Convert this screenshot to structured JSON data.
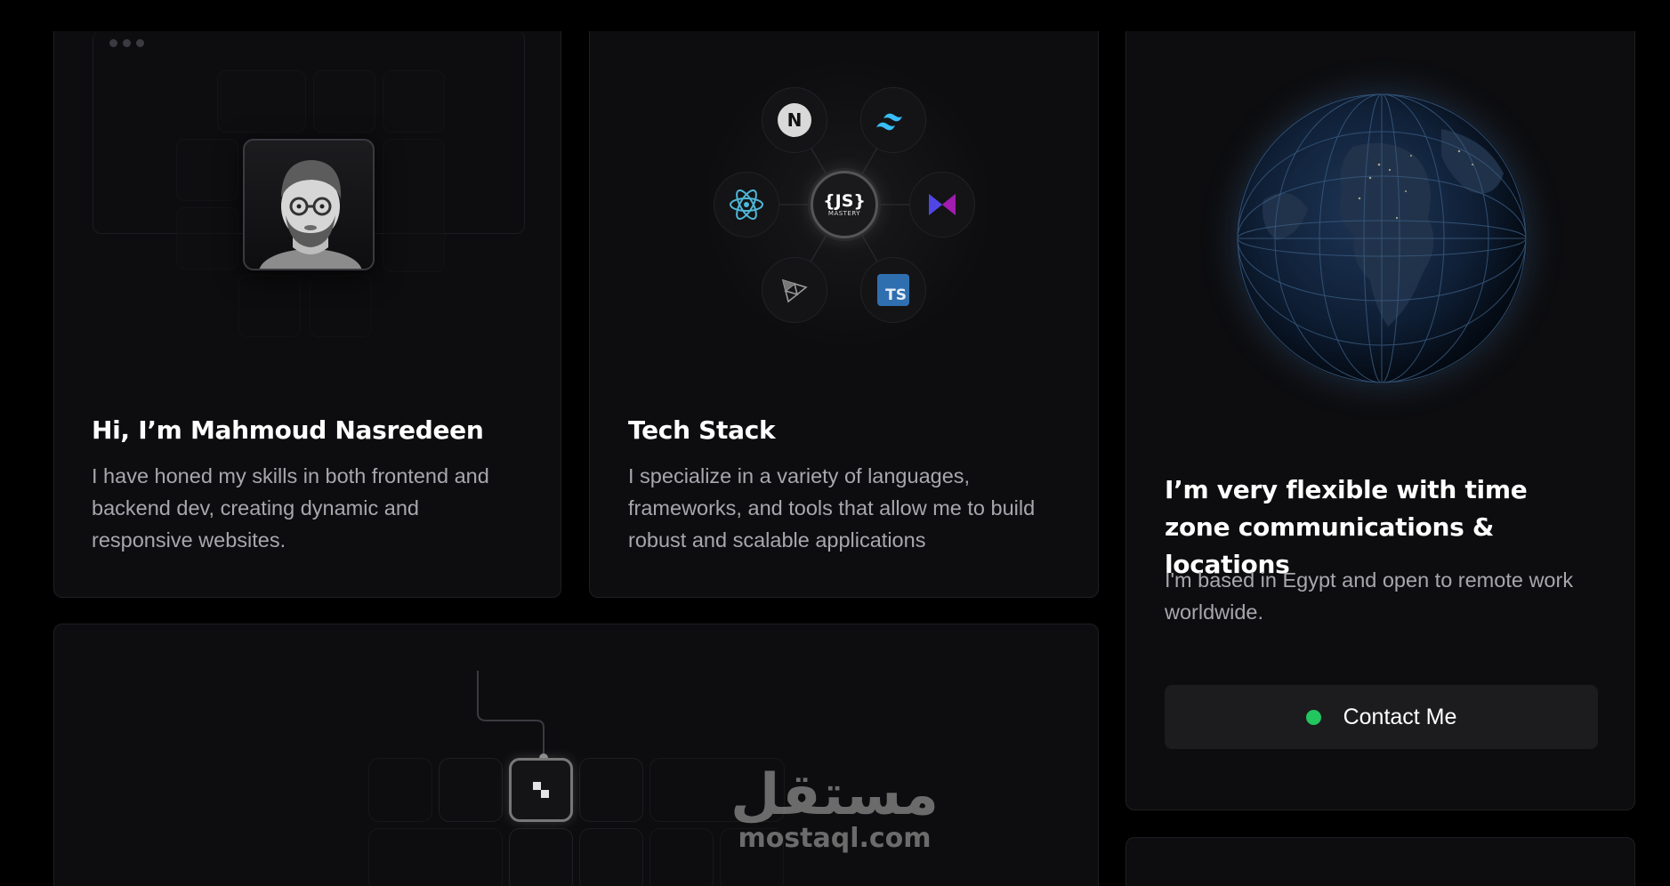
{
  "about": {
    "title": "Hi, I’m Mahmoud Nasredeen",
    "description": "I have honed my skills in both frontend and backend dev, creating dynamic and responsive websites."
  },
  "tech": {
    "title": "Tech Stack",
    "description": "I specialize in a variety of languages, frameworks, and tools that allow me to build robust and scalable applications",
    "center_logo_text": "{JS}",
    "center_logo_sub": "MASTERY",
    "icons": [
      "nextjs-icon",
      "tailwind-icon",
      "react-icon",
      "jsmastery-icon",
      "motion-icon",
      "threejs-icon",
      "typescript-icon"
    ],
    "ts_label": "TS",
    "n_label": "N"
  },
  "location": {
    "title": "I’m very flexible with time zone communications & locations",
    "description": "I'm based in Egypt and open to remote work worldwide.",
    "contact_label": "Contact Me",
    "status_color": "#22c55e"
  },
  "watermark": {
    "arabic": "مستقل",
    "latin": "mostaql.com"
  },
  "colors": {
    "background": "#000000",
    "card": "#0d0d0f",
    "accent_green": "#22c55e"
  }
}
